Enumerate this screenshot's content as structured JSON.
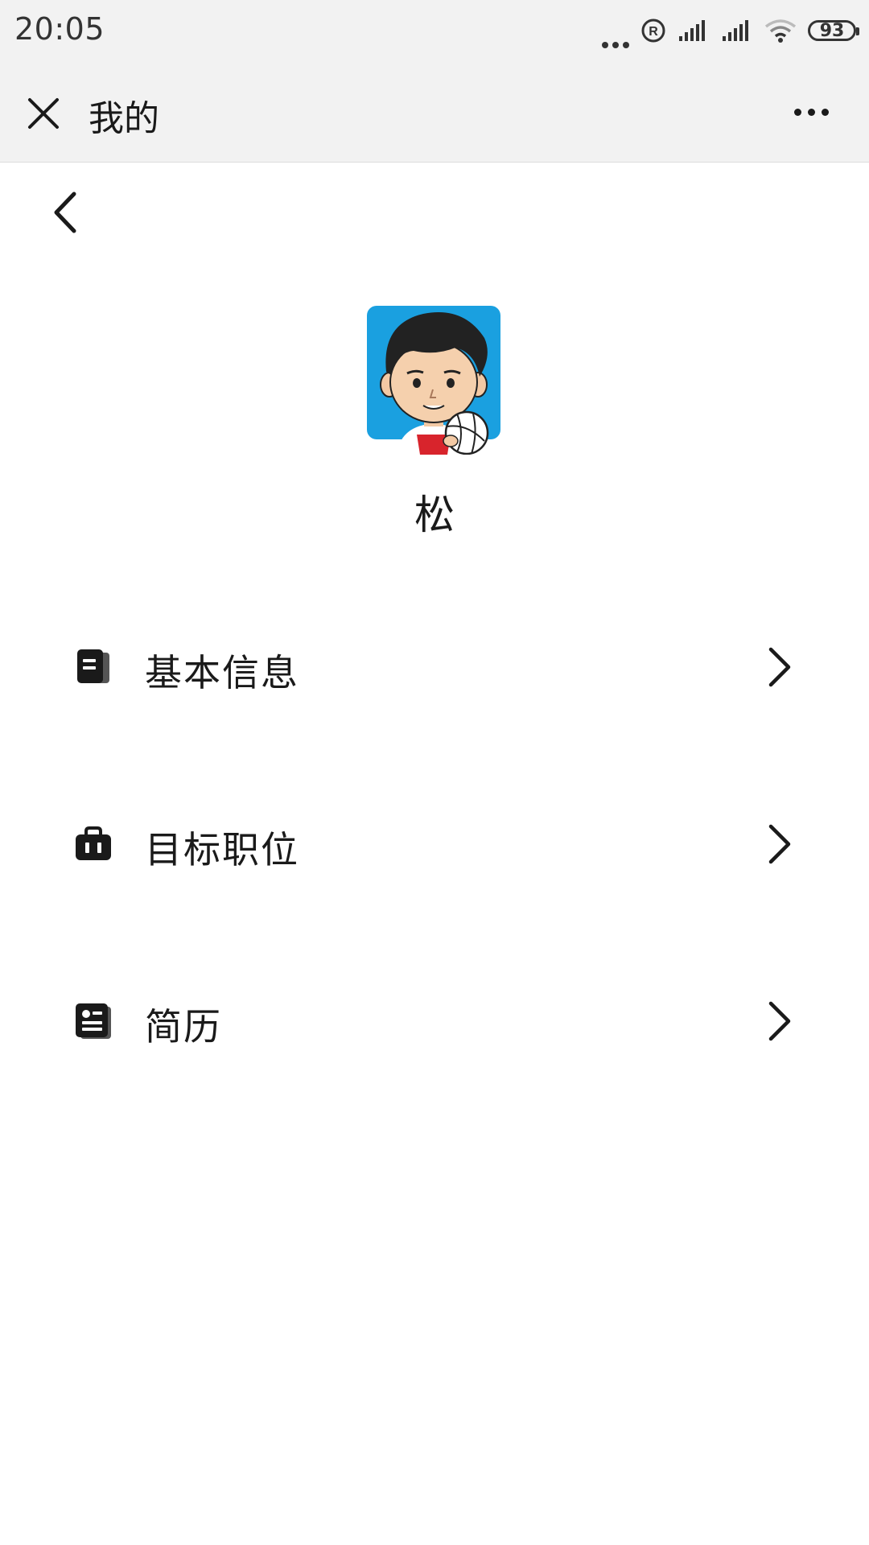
{
  "status_bar": {
    "time": "20:05",
    "battery": "93",
    "icons": [
      "more-dots-icon",
      "registered-icon",
      "signal-icon",
      "signal-icon",
      "wifi-icon",
      "battery-icon"
    ]
  },
  "title_bar": {
    "title": "我的",
    "close_icon": "close-icon",
    "more_icon": "more-icon"
  },
  "profile": {
    "name": "松",
    "avatar": "avatar-image"
  },
  "menu": {
    "items": [
      {
        "label": "基本信息",
        "icon": "document-icon"
      },
      {
        "label": "目标职位",
        "icon": "briefcase-icon"
      },
      {
        "label": "简历",
        "icon": "resume-card-icon"
      }
    ]
  },
  "colors": {
    "header_bg": "#f2f2f2",
    "page_bg": "#ffffff",
    "text": "#1a1a1a",
    "avatar_bg": "#1aa0e0"
  }
}
